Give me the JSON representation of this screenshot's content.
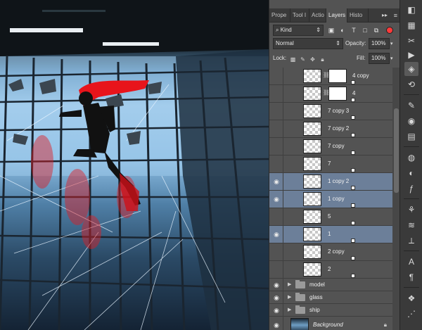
{
  "panel_tabs": [
    {
      "label": "Prope",
      "active": false
    },
    {
      "label": "Tool I",
      "active": false
    },
    {
      "label": "Actio",
      "active": false
    },
    {
      "label": "Layers",
      "active": true
    },
    {
      "label": "Histo",
      "active": false
    }
  ],
  "collapse_glyph": "▸▸",
  "panel_menu_glyph": "≡",
  "filter": {
    "kind_value": "Kind",
    "icons": [
      "image-filter-icon",
      "adjustment-filter-icon",
      "type-filter-icon",
      "shape-filter-icon",
      "smart-object-filter-icon"
    ],
    "icon_glyphs": [
      "▣",
      "◐",
      "T",
      "□",
      "⧉"
    ]
  },
  "blend": {
    "mode": "Normal",
    "opacity_label": "Opacity:",
    "opacity_value": "100%"
  },
  "lock": {
    "label": "Lock:",
    "fill_label": "Fill:",
    "fill_value": "100%"
  },
  "layers": [
    {
      "name": "4 copy",
      "visible": false,
      "selected": false,
      "type": "smart-mask"
    },
    {
      "name": "4",
      "visible": false,
      "selected": false,
      "type": "smart-mask"
    },
    {
      "name": "7 copy 3",
      "visible": false,
      "selected": false,
      "type": "smart"
    },
    {
      "name": "7 copy 2",
      "visible": false,
      "selected": false,
      "type": "smart"
    },
    {
      "name": "7 copy",
      "visible": false,
      "selected": false,
      "type": "smart"
    },
    {
      "name": "7",
      "visible": false,
      "selected": false,
      "type": "smart"
    },
    {
      "name": "1 copy 2",
      "visible": true,
      "selected": true,
      "type": "smart"
    },
    {
      "name": "1 copy",
      "visible": true,
      "selected": true,
      "type": "smart"
    },
    {
      "name": "5",
      "visible": false,
      "selected": false,
      "type": "smart"
    },
    {
      "name": "1",
      "visible": true,
      "selected": true,
      "type": "smart"
    },
    {
      "name": "2 copy",
      "visible": false,
      "selected": false,
      "type": "smart"
    },
    {
      "name": "2",
      "visible": false,
      "selected": false,
      "type": "smart"
    },
    {
      "name": "model",
      "visible": true,
      "selected": false,
      "type": "group"
    },
    {
      "name": "glass",
      "visible": true,
      "selected": false,
      "type": "group"
    },
    {
      "name": "ship",
      "visible": true,
      "selected": false,
      "type": "group"
    },
    {
      "name": "Background",
      "visible": true,
      "selected": false,
      "type": "background"
    }
  ],
  "strip_icons": [
    {
      "name": "color-icon",
      "glyph": "◧"
    },
    {
      "name": "swatches-icon",
      "glyph": "▦"
    },
    {
      "name": "tools-icon",
      "glyph": "✂"
    },
    {
      "name": "play-icon",
      "glyph": "▶"
    },
    {
      "name": "layers-icon",
      "glyph": "◈"
    },
    {
      "name": "history-icon",
      "glyph": "⟲"
    },
    {
      "name": "brush-settings-icon",
      "glyph": "✎"
    },
    {
      "name": "navigator-icon",
      "glyph": "◉"
    },
    {
      "name": "info-icon",
      "glyph": "▤"
    },
    {
      "name": "styles-icon",
      "glyph": "◍"
    },
    {
      "name": "adjustments-icon",
      "glyph": "◐"
    },
    {
      "name": "masks-icon",
      "glyph": "ƒ"
    },
    {
      "name": "clone-source-icon",
      "glyph": "⚘"
    },
    {
      "name": "channels-icon",
      "glyph": "≋"
    },
    {
      "name": "paths-icon",
      "glyph": "⟂"
    },
    {
      "name": "character-icon",
      "glyph": "A"
    },
    {
      "name": "paragraph-icon",
      "glyph": "¶"
    },
    {
      "name": "3d-icon",
      "glyph": "❖"
    },
    {
      "name": "timeline-icon",
      "glyph": "⋰"
    }
  ],
  "colors": {
    "selection": "#6c7f99",
    "panel": "#535353",
    "hair": "#e8141b"
  }
}
